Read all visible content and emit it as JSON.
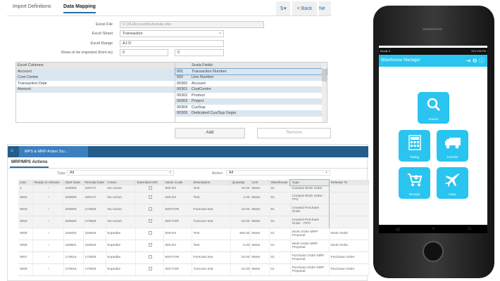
{
  "import_window": {
    "tabs": [
      "Import Definitions",
      "Data Mapping"
    ],
    "toolbar": {
      "sort_icon": "sort-icon",
      "back": "< Back",
      "next": "Ne"
    },
    "form": {
      "excel_file_label": "Excel File",
      "excel_file_value": "C:\\XL\\AccountSchedule.xlsx",
      "excel_sheet_label": "Excel Sheet",
      "excel_sheet_value": "Transaction",
      "excel_range_label": "Excel Range",
      "excel_range_value": "A1:D",
      "rows_label": "Rows to be imported (from-to)",
      "rows_from": "0",
      "rows_to": "0"
    },
    "excel_columns": {
      "header": "Excel Columns",
      "items": [
        "Account",
        "Cost Centre",
        "Transaction Date",
        "Amount"
      ]
    },
    "scala_fields": {
      "header": "Scala Fields",
      "items": [
        {
          "code": "001",
          "name": "Transaction Number"
        },
        {
          "code": "002",
          "name": "Line Number"
        },
        {
          "code": "00300",
          "name": "Account"
        },
        {
          "code": "00301",
          "name": "CostCentre"
        },
        {
          "code": "00302",
          "name": "Product"
        },
        {
          "code": "00303",
          "name": "Project"
        },
        {
          "code": "00304",
          "name": "CusSup"
        },
        {
          "code": "00305",
          "name": "Dedicated Cus/Sup Segm"
        }
      ]
    },
    "add": "Add",
    "remove": "Remove"
  },
  "mrp_window": {
    "window_tab": "MPS & MRP Action Scr...",
    "sub_tab": "MRP/MPS Actions",
    "type_label": "Type",
    "type_value": "All",
    "action_label": "Action",
    "action_value": "All",
    "columns": [
      "Line",
      "Ready to release",
      "Start Date",
      "Receipt Date",
      "Action",
      "Extended Info",
      "Stock Code",
      "Description",
      "Quantity",
      "Unit",
      "Warehouse",
      "Type",
      "Release To"
    ],
    "rows": [
      [
        "1",
        "",
        "200000",
        "190727",
        "No Action",
        "",
        "600 EX",
        "Test",
        "10.00",
        "Meter",
        "01",
        "Created Work Order",
        ""
      ],
      [
        "0002",
        "",
        "200000",
        "190727",
        "No Action",
        "",
        "600 EX",
        "Test",
        "1.00",
        "Meter",
        "01",
        "Created Work Order - TPC",
        ""
      ],
      [
        "0003",
        "",
        "200000",
        "170926",
        "No Action",
        "",
        "600-FOR",
        "Forecast test",
        "10.00",
        "Meter",
        "01",
        "Created Purchase Order",
        ""
      ],
      [
        "0004",
        "",
        "200000",
        "170926",
        "No Action",
        "",
        "600 FOR",
        "Turnover test",
        "10.00",
        "Meter",
        "01",
        "Created Purchase Order - FPO",
        ""
      ],
      [
        "0005",
        "",
        "160000",
        "160926",
        "Expedite",
        "",
        "600-EX",
        "Test",
        "400.00",
        "Meter",
        "01",
        "Work Order MRP Proposal",
        "Work Order"
      ],
      [
        "0006",
        "",
        "160601",
        "160926",
        "Expedite",
        "",
        "600 EX",
        "Test",
        "5.00",
        "Meter",
        "01",
        "Work Order MRP Proposal",
        "Work Order"
      ],
      [
        "0007",
        "",
        "170615",
        "170926",
        "Expedite",
        "",
        "600-FOR",
        "Forecast test",
        "10.00",
        "Meter",
        "01",
        "Purchase Order MRP Proposal",
        "Purchase Order"
      ],
      [
        "0008",
        "",
        "170616",
        "170926",
        "Expedite",
        "",
        "600 FOR",
        "Turnover test",
        "10.00",
        "Meter",
        "01",
        "Purchase Order MRP Proposal",
        "Purchase Order"
      ]
    ]
  },
  "phone": {
    "status_left": "Bsnl ▶ ⊟",
    "status_right": "19% 5:55 PM",
    "app_title": "Warehouse Manager",
    "tiles": [
      "Search",
      "Taking",
      "Transfer",
      "Receipt",
      "Issue"
    ],
    "accent": "#29c5f0"
  }
}
